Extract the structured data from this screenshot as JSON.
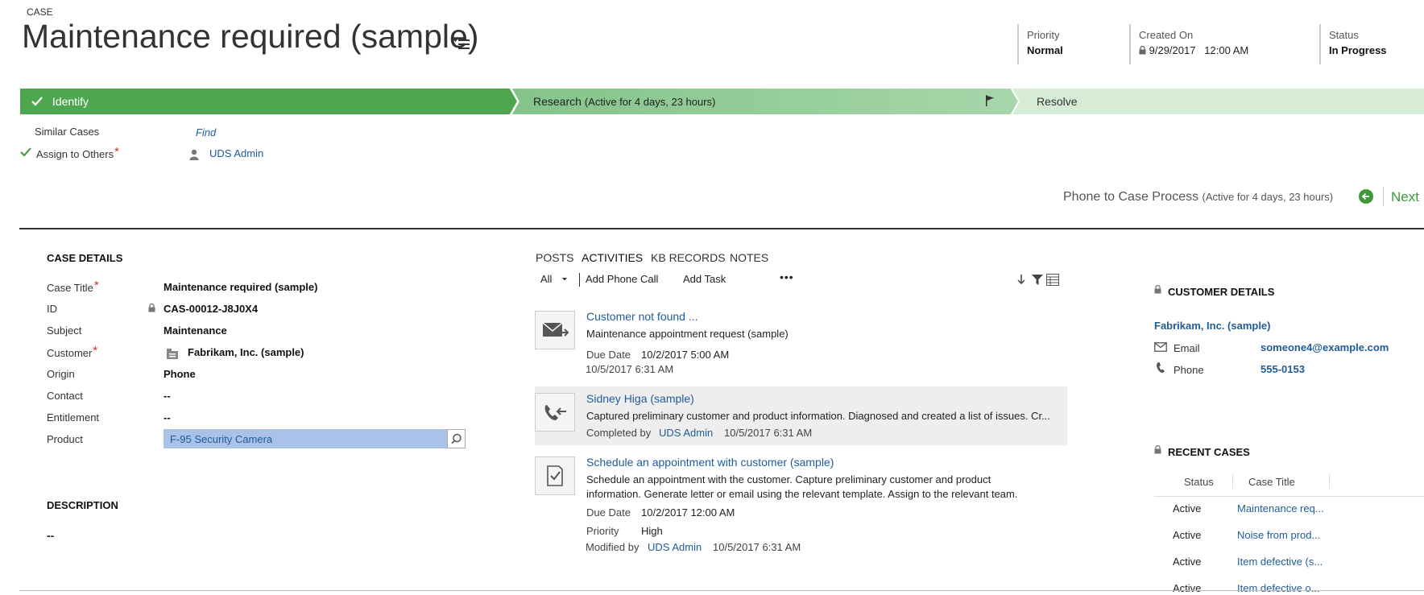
{
  "header": {
    "entity_type": "CASE",
    "title": "Maintenance required (sample)",
    "fields": [
      {
        "label": "Priority",
        "value": "Normal"
      },
      {
        "label": "Created On",
        "value": "9/29/2017   12:00 AM"
      },
      {
        "label": "Status",
        "value": "In Progress"
      }
    ]
  },
  "process": {
    "stages": {
      "identify": "Identify",
      "research": "Research",
      "research_sub": "(Active for 4 days, 23 hours)",
      "resolve": "Resolve"
    },
    "steps": {
      "similar_cases_label": "Similar Cases",
      "similar_cases_value": "Find",
      "assign_label": "Assign to Others",
      "assign_value": "UDS Admin"
    },
    "process_name": "Phone to Case Process",
    "process_active": "(Active for 4 days, 23 hours)",
    "next_label": "Next"
  },
  "case_details": {
    "heading": "CASE DETAILS",
    "fields": [
      {
        "label": "Case Title",
        "value": "Maintenance required (sample)"
      },
      {
        "label": "ID",
        "value": "CAS-00012-J8J0X4"
      },
      {
        "label": "Subject",
        "value": "Maintenance"
      },
      {
        "label": "Customer",
        "value": "Fabrikam, Inc. (sample)"
      },
      {
        "label": "Origin",
        "value": "Phone"
      },
      {
        "label": "Contact",
        "value": "--"
      },
      {
        "label": "Entitlement",
        "value": "--"
      },
      {
        "label": "Product",
        "value": "F-95 Security Camera"
      }
    ],
    "description_heading": "DESCRIPTION",
    "description_value": "--"
  },
  "activities": {
    "tabs": [
      "POSTS",
      "ACTIVITIES",
      "KB RECORDS",
      "NOTES"
    ],
    "filter": "All",
    "add_phone_call": "Add Phone Call",
    "add_task": "Add Task",
    "more": "•••",
    "items": [
      {
        "icon": "email-icon",
        "title": "Customer not found ...",
        "line1": "Maintenance appointment request (sample)",
        "meta_label": "Due Date",
        "meta_value": "10/2/2017 5:00 AM",
        "timestamp": "10/5/2017 6:31 AM"
      },
      {
        "icon": "phone-call-icon",
        "title": "Sidney Higa (sample)",
        "line1": "Captured preliminary customer and product information. Diagnosed and created a list of issues. Cr...",
        "meta_label": "Completed by",
        "meta_user": "UDS Admin",
        "timestamp": "10/5/2017 6:31 AM"
      },
      {
        "icon": "task-icon",
        "title": "Schedule an appointment with customer (sample)",
        "line1": "Schedule an appointment with the customer. Capture preliminary customer and product",
        "line2": "information. Generate letter or email using the relevant template. Assign to the relevant team.",
        "due_label": "Due Date",
        "due_value": "10/2/2017 12:00 AM",
        "priority_label": "Priority",
        "priority_value": "High",
        "modified_label": "Modified by",
        "modified_user": "UDS Admin",
        "timestamp": "10/5/2017 6:31 AM"
      }
    ]
  },
  "customer_details": {
    "heading": "CUSTOMER DETAILS",
    "name": "Fabrikam, Inc. (sample)",
    "email_label": "Email",
    "email_value": "someone4@example.com",
    "phone_label": "Phone",
    "phone_value": "555-0153"
  },
  "recent_cases": {
    "heading": "RECENT CASES",
    "columns": [
      "Status",
      "Case Title"
    ],
    "rows": [
      {
        "status": "Active",
        "title": "Maintenance req..."
      },
      {
        "status": "Active",
        "title": "Noise from prod..."
      },
      {
        "status": "Active",
        "title": "Item defective (s..."
      },
      {
        "status": "Active",
        "title": "Item defective o..."
      }
    ]
  },
  "colors": {
    "accent_green": "#4ea64e",
    "link_blue": "#1f5c99",
    "required_red": "#c0392b"
  }
}
